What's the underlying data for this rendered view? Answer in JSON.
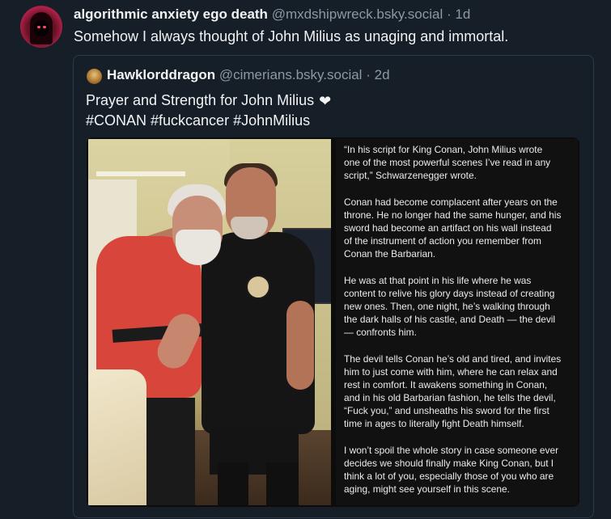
{
  "post": {
    "author_name": "algorithmic anxiety ego death",
    "author_handle": "@mxdshipwreck.bsky.social",
    "separator": "·",
    "time": "1d",
    "text": "Somehow I always thought of John Milius as unaging and immortal."
  },
  "quote": {
    "author_name": "Hawklorddragon",
    "author_handle": "@cimerians.bsky.social",
    "separator": "·",
    "time": "2d",
    "text_line1": "Prayer and Strength for John Milius",
    "heart": "❤",
    "text_line2": "#CONAN #fuckcancer #JohnMilius"
  },
  "article": {
    "lines": [
      "“In his script for King Conan, John Milius wrote",
      "one of the most powerful scenes I’ve read in any",
      "script,” Schwarzenegger wrote.",
      "Conan had become complacent after years on the",
      "throne. He no longer had the same hunger, and his",
      "sword had become an artifact on his wall instead",
      "of the instrument of action you remember from",
      "Conan the Barbarian.",
      "He was at that point in his life where he was",
      "content to relive his glory days instead of creating",
      "new ones. Then, one night, he’s walking through",
      "the dark halls of his castle, and Death — the devil",
      "— confronts him.",
      "The devil tells Conan he’s old and tired, and invites",
      "him to just come with him, where he can relax and",
      "rest in comfort. It awakens something in Conan,",
      "and in his old Barbarian fashion, he tells the devil,",
      "“Fuck you,” and unsheaths his sword for the first",
      "time in ages to literally fight Death himself.",
      "I won’t spoil the whole story in case someone ever",
      "decides we should finally make King Conan, but I",
      "think a lot of you, especially those of you who are",
      "aging, might see yourself in this scene."
    ]
  },
  "colors": {
    "background": "#161e27",
    "muted_text": "#8d98a5",
    "border": "#2e3a48",
    "heart": "#ffffff"
  }
}
